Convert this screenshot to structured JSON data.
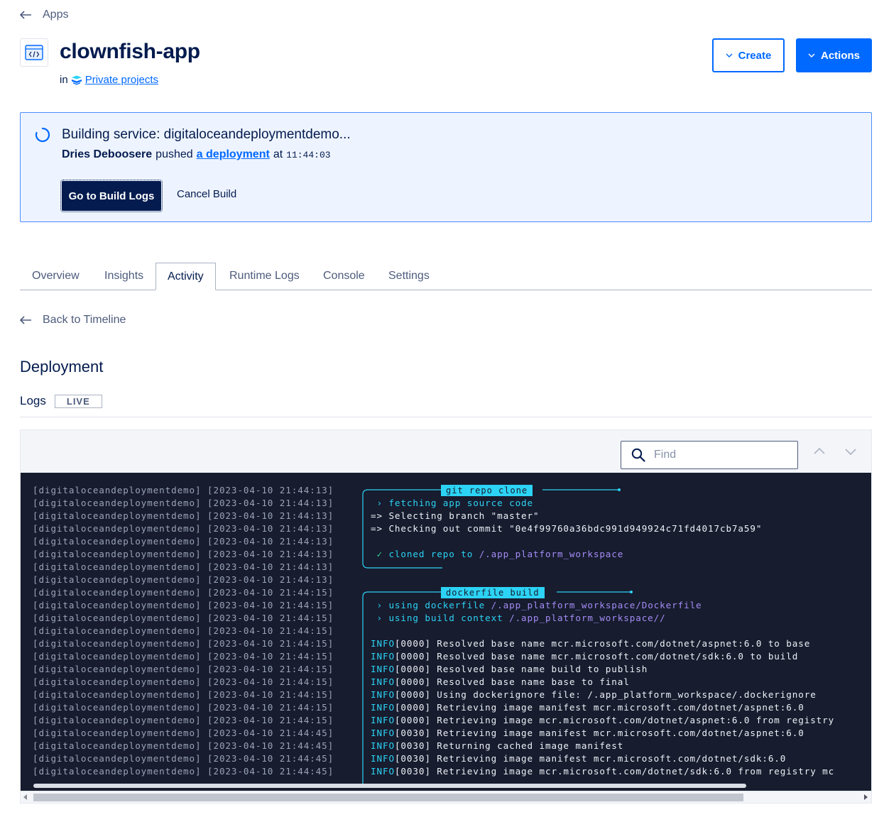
{
  "nav": {
    "back_label": "Apps"
  },
  "app": {
    "title": "clownfish-app",
    "in_label": "in",
    "project_label": "Private projects"
  },
  "header_buttons": {
    "create_label": "Create",
    "actions_label": "Actions"
  },
  "banner": {
    "title": "Building service: digitaloceandeploymentdemo...",
    "author": "Dries Deboosere",
    "pushed": "pushed",
    "deployment_link": "a deployment",
    "at": "at",
    "time": "11:44:03",
    "go_logs_label": "Go to Build Logs",
    "cancel_label": "Cancel Build"
  },
  "tabs": [
    {
      "label": "Overview",
      "active": false
    },
    {
      "label": "Insights",
      "active": false
    },
    {
      "label": "Activity",
      "active": true
    },
    {
      "label": "Runtime Logs",
      "active": false
    },
    {
      "label": "Console",
      "active": false
    },
    {
      "label": "Settings",
      "active": false
    }
  ],
  "timeline": {
    "back_label": "Back to Timeline"
  },
  "deployment": {
    "heading": "Deployment",
    "logs_label": "Logs",
    "live_badge": "LIVE"
  },
  "log_viewer": {
    "find_placeholder": "Find",
    "boxes": [
      {
        "label": "git repo clone"
      },
      {
        "label": "dockerfile build"
      }
    ],
    "lines": [
      {
        "prefix": "[digitaloceandeploymentdemo] [2023-04-10 21:44:13]",
        "parts": []
      },
      {
        "prefix": "[digitaloceandeploymentdemo] [2023-04-10 21:44:13]",
        "parts": [
          {
            "t": " › fetching app source code",
            "c": "cyan"
          }
        ]
      },
      {
        "prefix": "[digitaloceandeploymentdemo] [2023-04-10 21:44:13]",
        "parts": [
          {
            "t": "=> Selecting branch \"master\"",
            "c": "white"
          }
        ]
      },
      {
        "prefix": "[digitaloceandeploymentdemo] [2023-04-10 21:44:13]",
        "parts": [
          {
            "t": "=> Checking out commit \"0e4f99760a36bdc991d949924c71fd4017cb7a59\"",
            "c": "white"
          }
        ]
      },
      {
        "prefix": "[digitaloceandeploymentdemo] [2023-04-10 21:44:13]",
        "parts": []
      },
      {
        "prefix": "[digitaloceandeploymentdemo] [2023-04-10 21:44:13]",
        "parts": [
          {
            "t": " ✓ ",
            "c": "green"
          },
          {
            "t": "cloned repo to ",
            "c": "cyan"
          },
          {
            "t": "/.app_platform_workspace",
            "c": "purple"
          }
        ]
      },
      {
        "prefix": "[digitaloceandeploymentdemo] [2023-04-10 21:44:13]",
        "parts": []
      },
      {
        "prefix": "[digitaloceandeploymentdemo] [2023-04-10 21:44:13]",
        "parts": []
      },
      {
        "prefix": "[digitaloceandeploymentdemo] [2023-04-10 21:44:15]",
        "parts": []
      },
      {
        "prefix": "[digitaloceandeploymentdemo] [2023-04-10 21:44:15]",
        "parts": [
          {
            "t": " › using dockerfile ",
            "c": "cyan"
          },
          {
            "t": "/.app_platform_workspace/Dockerfile",
            "c": "purple"
          }
        ]
      },
      {
        "prefix": "[digitaloceandeploymentdemo] [2023-04-10 21:44:15]",
        "parts": [
          {
            "t": " › using build context ",
            "c": "cyan"
          },
          {
            "t": "/.app_platform_workspace//",
            "c": "purple"
          }
        ]
      },
      {
        "prefix": "[digitaloceandeploymentdemo] [2023-04-10 21:44:15]",
        "parts": []
      },
      {
        "prefix": "[digitaloceandeploymentdemo] [2023-04-10 21:44:15]",
        "parts": [
          {
            "t": "INFO",
            "c": "cyan"
          },
          {
            "t": "[0000] Resolved base name mcr.microsoft.com/dotnet/aspnet:6.0 to base",
            "c": "white"
          }
        ]
      },
      {
        "prefix": "[digitaloceandeploymentdemo] [2023-04-10 21:44:15]",
        "parts": [
          {
            "t": "INFO",
            "c": "cyan"
          },
          {
            "t": "[0000] Resolved base name mcr.microsoft.com/dotnet/sdk:6.0 to build",
            "c": "white"
          }
        ]
      },
      {
        "prefix": "[digitaloceandeploymentdemo] [2023-04-10 21:44:15]",
        "parts": [
          {
            "t": "INFO",
            "c": "cyan"
          },
          {
            "t": "[0000] Resolved base name build to publish",
            "c": "white"
          }
        ]
      },
      {
        "prefix": "[digitaloceandeploymentdemo] [2023-04-10 21:44:15]",
        "parts": [
          {
            "t": "INFO",
            "c": "cyan"
          },
          {
            "t": "[0000] Resolved base name base to final",
            "c": "white"
          }
        ]
      },
      {
        "prefix": "[digitaloceandeploymentdemo] [2023-04-10 21:44:15]",
        "parts": [
          {
            "t": "INFO",
            "c": "cyan"
          },
          {
            "t": "[0000] Using dockerignore file: /.app_platform_workspace/.dockerignore",
            "c": "white"
          }
        ]
      },
      {
        "prefix": "[digitaloceandeploymentdemo] [2023-04-10 21:44:15]",
        "parts": [
          {
            "t": "INFO",
            "c": "cyan"
          },
          {
            "t": "[0000] Retrieving image manifest mcr.microsoft.com/dotnet/aspnet:6.0",
            "c": "white"
          }
        ]
      },
      {
        "prefix": "[digitaloceandeploymentdemo] [2023-04-10 21:44:15]",
        "parts": [
          {
            "t": "INFO",
            "c": "cyan"
          },
          {
            "t": "[0000] Retrieving image mcr.microsoft.com/dotnet/aspnet:6.0 from registry",
            "c": "white"
          }
        ]
      },
      {
        "prefix": "[digitaloceandeploymentdemo] [2023-04-10 21:44:45]",
        "parts": [
          {
            "t": "INFO",
            "c": "cyan"
          },
          {
            "t": "[0030] Retrieving image manifest mcr.microsoft.com/dotnet/aspnet:6.0",
            "c": "white"
          }
        ]
      },
      {
        "prefix": "[digitaloceandeploymentdemo] [2023-04-10 21:44:45]",
        "parts": [
          {
            "t": "INFO",
            "c": "cyan"
          },
          {
            "t": "[0030] Returning cached image manifest",
            "c": "white"
          }
        ]
      },
      {
        "prefix": "[digitaloceandeploymentdemo] [2023-04-10 21:44:45]",
        "parts": [
          {
            "t": "INFO",
            "c": "cyan"
          },
          {
            "t": "[0030] Retrieving image manifest mcr.microsoft.com/dotnet/sdk:6.0",
            "c": "white"
          }
        ]
      },
      {
        "prefix": "[digitaloceandeploymentdemo] [2023-04-10 21:44:45]",
        "parts": [
          {
            "t": "INFO",
            "c": "cyan"
          },
          {
            "t": "[0030] Retrieving image mcr.microsoft.com/dotnet/sdk:6.0 from registry mc",
            "c": "white"
          }
        ]
      }
    ]
  },
  "colors": {
    "accent": "#0069ff",
    "navy": "#031b4e",
    "terminal_bg": "#171c2e",
    "log_cyan": "#2cd3f5",
    "log_purple": "#a48cf6",
    "log_green": "#35d49a"
  }
}
